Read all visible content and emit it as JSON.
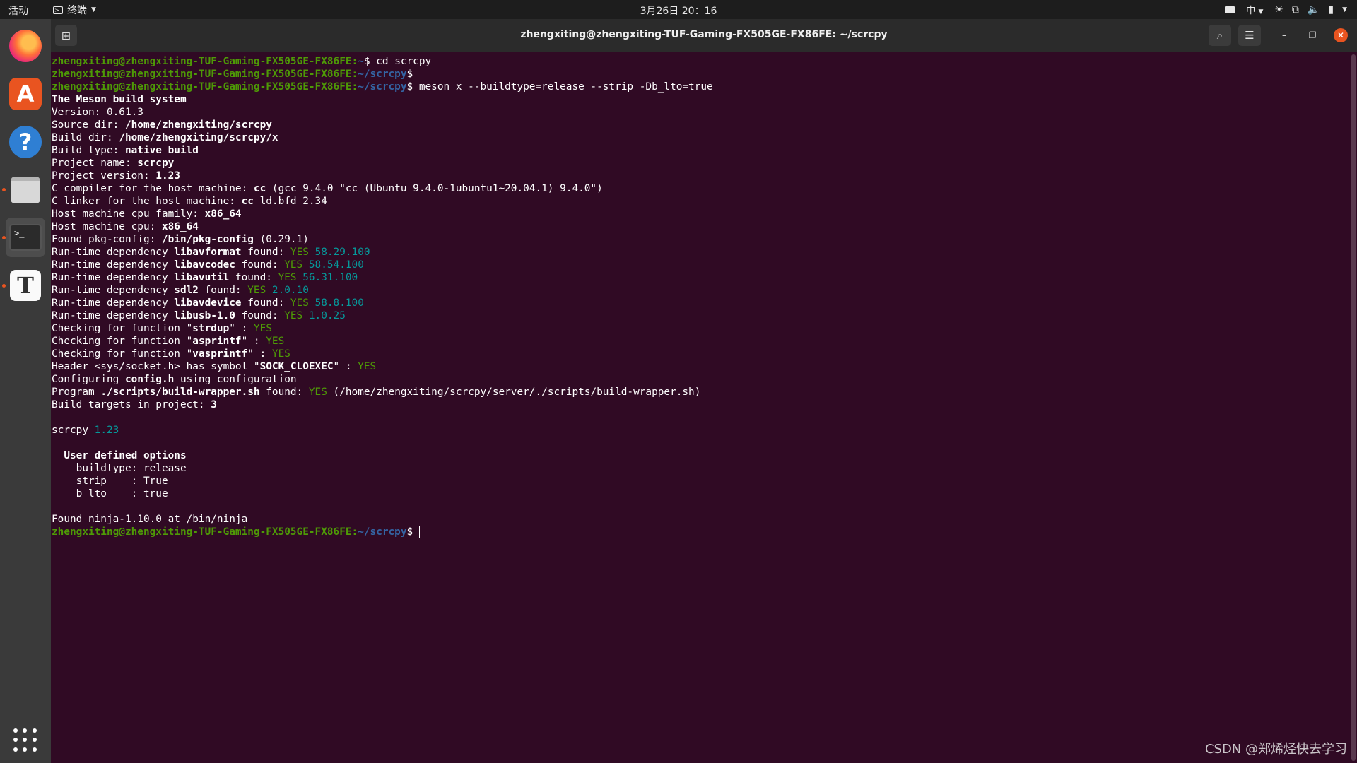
{
  "topbar": {
    "activities": "活动",
    "app_name": "终端",
    "clock": "3月26日 20：16",
    "input_method": "中"
  },
  "dock": {
    "items": [
      {
        "name": "firefox"
      },
      {
        "name": "ubuntu-software",
        "glyph": "A"
      },
      {
        "name": "help",
        "glyph": "?"
      },
      {
        "name": "files"
      },
      {
        "name": "terminal",
        "glyph": ">_"
      },
      {
        "name": "typora",
        "glyph": "T"
      },
      {
        "name": "show-applications"
      }
    ]
  },
  "window": {
    "title": "zhengxiting@zhengxiting-TUF-Gaming-FX505GE-FX86FE: ~/scrcpy"
  },
  "terminal": {
    "colors": {
      "prompt_user": "#4e9a06",
      "prompt_path": "#3465a4",
      "yes": "#4e9a06",
      "version": "#06989a",
      "background": "#300a24"
    },
    "lines": [
      [
        {
          "t": "zhengxiting@zhengxiting-TUF-Gaming-FX505GE-FX86FE:",
          "c": "pu"
        },
        {
          "t": "~",
          "c": "pp"
        },
        {
          "t": "$ cd scrcpy"
        }
      ],
      [
        {
          "t": "zhengxiting@zhengxiting-TUF-Gaming-FX505GE-FX86FE:",
          "c": "pu"
        },
        {
          "t": "~/scrcpy",
          "c": "pp"
        },
        {
          "t": "$"
        }
      ],
      [
        {
          "t": "zhengxiting@zhengxiting-TUF-Gaming-FX505GE-FX86FE:",
          "c": "pu"
        },
        {
          "t": "~/scrcpy",
          "c": "pp"
        },
        {
          "t": "$ meson x --buildtype=release --strip -Db_lto=true"
        }
      ],
      [
        {
          "t": "The Meson build system",
          "c": "b"
        }
      ],
      [
        {
          "t": "Version: 0.61.3"
        }
      ],
      [
        {
          "t": "Source dir: "
        },
        {
          "t": "/home/zhengxiting/scrcpy",
          "c": "b"
        }
      ],
      [
        {
          "t": "Build dir: "
        },
        {
          "t": "/home/zhengxiting/scrcpy/x",
          "c": "b"
        }
      ],
      [
        {
          "t": "Build type: "
        },
        {
          "t": "native build",
          "c": "b"
        }
      ],
      [
        {
          "t": "Project name: "
        },
        {
          "t": "scrcpy",
          "c": "b"
        }
      ],
      [
        {
          "t": "Project version: "
        },
        {
          "t": "1.23",
          "c": "b"
        }
      ],
      [
        {
          "t": "C compiler for the host machine: "
        },
        {
          "t": "cc",
          "c": "b"
        },
        {
          "t": " (gcc 9.4.0 \"cc (Ubuntu 9.4.0-1ubuntu1~20.04.1) 9.4.0\")"
        }
      ],
      [
        {
          "t": "C linker for the host machine: "
        },
        {
          "t": "cc",
          "c": "b"
        },
        {
          "t": " ld.bfd 2.34"
        }
      ],
      [
        {
          "t": "Host machine cpu family: "
        },
        {
          "t": "x86_64",
          "c": "b"
        }
      ],
      [
        {
          "t": "Host machine cpu: "
        },
        {
          "t": "x86_64",
          "c": "b"
        }
      ],
      [
        {
          "t": "Found pkg-config: "
        },
        {
          "t": "/bin/pkg-config",
          "c": "b"
        },
        {
          "t": " (0.29.1)"
        }
      ],
      [
        {
          "t": "Run-time dependency "
        },
        {
          "t": "libavformat",
          "c": "b"
        },
        {
          "t": " found: "
        },
        {
          "t": "YES",
          "c": "ok"
        },
        {
          "t": " 58.29.100",
          "c": "ver"
        }
      ],
      [
        {
          "t": "Run-time dependency "
        },
        {
          "t": "libavcodec",
          "c": "b"
        },
        {
          "t": " found: "
        },
        {
          "t": "YES",
          "c": "ok"
        },
        {
          "t": " 58.54.100",
          "c": "ver"
        }
      ],
      [
        {
          "t": "Run-time dependency "
        },
        {
          "t": "libavutil",
          "c": "b"
        },
        {
          "t": " found: "
        },
        {
          "t": "YES",
          "c": "ok"
        },
        {
          "t": " 56.31.100",
          "c": "ver"
        }
      ],
      [
        {
          "t": "Run-time dependency "
        },
        {
          "t": "sdl2",
          "c": "b"
        },
        {
          "t": " found: "
        },
        {
          "t": "YES",
          "c": "ok"
        },
        {
          "t": " 2.0.10",
          "c": "ver"
        }
      ],
      [
        {
          "t": "Run-time dependency "
        },
        {
          "t": "libavdevice",
          "c": "b"
        },
        {
          "t": " found: "
        },
        {
          "t": "YES",
          "c": "ok"
        },
        {
          "t": " 58.8.100",
          "c": "ver"
        }
      ],
      [
        {
          "t": "Run-time dependency "
        },
        {
          "t": "libusb-1.0",
          "c": "b"
        },
        {
          "t": " found: "
        },
        {
          "t": "YES",
          "c": "ok"
        },
        {
          "t": " 1.0.25",
          "c": "ver"
        }
      ],
      [
        {
          "t": "Checking for function \""
        },
        {
          "t": "strdup",
          "c": "b"
        },
        {
          "t": "\" : "
        },
        {
          "t": "YES",
          "c": "ok"
        }
      ],
      [
        {
          "t": "Checking for function \""
        },
        {
          "t": "asprintf",
          "c": "b"
        },
        {
          "t": "\" : "
        },
        {
          "t": "YES",
          "c": "ok"
        }
      ],
      [
        {
          "t": "Checking for function \""
        },
        {
          "t": "vasprintf",
          "c": "b"
        },
        {
          "t": "\" : "
        },
        {
          "t": "YES",
          "c": "ok"
        }
      ],
      [
        {
          "t": "Header <sys/socket.h> has symbol \""
        },
        {
          "t": "SOCK_CLOEXEC",
          "c": "b"
        },
        {
          "t": "\" : "
        },
        {
          "t": "YES",
          "c": "ok"
        }
      ],
      [
        {
          "t": "Configuring "
        },
        {
          "t": "config.h",
          "c": "b"
        },
        {
          "t": " using configuration"
        }
      ],
      [
        {
          "t": "Program "
        },
        {
          "t": "./scripts/build-wrapper.sh",
          "c": "b"
        },
        {
          "t": " found: "
        },
        {
          "t": "YES",
          "c": "ok"
        },
        {
          "t": " (/home/zhengxiting/scrcpy/server/./scripts/build-wrapper.sh)"
        }
      ],
      [
        {
          "t": "Build targets in project: "
        },
        {
          "t": "3",
          "c": "b"
        }
      ],
      [
        {
          "t": ""
        }
      ],
      [
        {
          "t": "scrcpy "
        },
        {
          "t": "1.23",
          "c": "ver"
        }
      ],
      [
        {
          "t": ""
        }
      ],
      [
        {
          "t": "  "
        },
        {
          "t": "User defined options",
          "c": "b"
        }
      ],
      [
        {
          "t": "    buildtype: release"
        }
      ],
      [
        {
          "t": "    strip    : True"
        }
      ],
      [
        {
          "t": "    b_lto    : true"
        }
      ],
      [
        {
          "t": ""
        }
      ],
      [
        {
          "t": "Found ninja-1.10.0 at /bin/ninja"
        }
      ],
      [
        {
          "t": "zhengxiting@zhengxiting-TUF-Gaming-FX505GE-FX86FE:",
          "c": "pu"
        },
        {
          "t": "~/scrcpy",
          "c": "pp"
        },
        {
          "t": "$ "
        },
        {
          "cursor": true
        }
      ]
    ]
  },
  "watermark": "CSDN @郑烯烃快去学习"
}
